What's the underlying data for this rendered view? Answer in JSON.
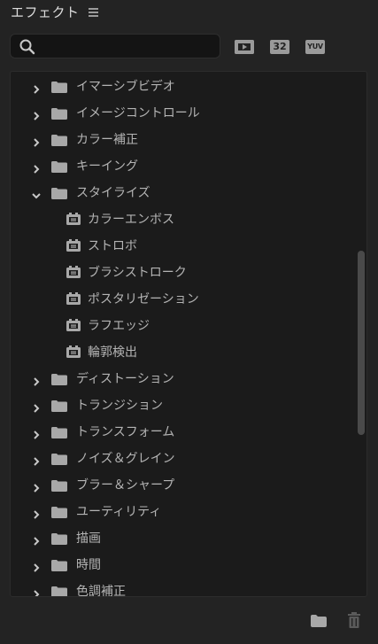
{
  "panel": {
    "title": "エフェクト"
  },
  "search": {
    "value": "",
    "placeholder": ""
  },
  "filters": {
    "accelerated": "",
    "bit32": "32",
    "yuv": "YUV"
  },
  "tree": {
    "items": [
      {
        "label": "イマーシブビデオ",
        "type": "folder",
        "expanded": false
      },
      {
        "label": "イメージコントロール",
        "type": "folder",
        "expanded": false
      },
      {
        "label": "カラー補正",
        "type": "folder",
        "expanded": false
      },
      {
        "label": "キーイング",
        "type": "folder",
        "expanded": false
      },
      {
        "label": "スタイライズ",
        "type": "folder",
        "expanded": true
      },
      {
        "label": "カラーエンボス",
        "type": "effect"
      },
      {
        "label": "ストロボ",
        "type": "effect"
      },
      {
        "label": "ブラシストローク",
        "type": "effect"
      },
      {
        "label": "ポスタリゼーション",
        "type": "effect"
      },
      {
        "label": "ラフエッジ",
        "type": "effect"
      },
      {
        "label": "輪郭検出",
        "type": "effect"
      },
      {
        "label": "ディストーション",
        "type": "folder",
        "expanded": false
      },
      {
        "label": "トランジション",
        "type": "folder",
        "expanded": false
      },
      {
        "label": "トランスフォーム",
        "type": "folder",
        "expanded": false
      },
      {
        "label": "ノイズ＆グレイン",
        "type": "folder",
        "expanded": false
      },
      {
        "label": "ブラー＆シャープ",
        "type": "folder",
        "expanded": false
      },
      {
        "label": "ユーティリティ",
        "type": "folder",
        "expanded": false
      },
      {
        "label": "描画",
        "type": "folder",
        "expanded": false
      },
      {
        "label": "時間",
        "type": "folder",
        "expanded": false
      },
      {
        "label": "色調補正",
        "type": "folder",
        "expanded": false
      }
    ]
  },
  "colors": {
    "background": "#232323",
    "tree_bg": "#1b1b1b",
    "text": "#b4b4b4",
    "icon": "#a8a8a8"
  }
}
